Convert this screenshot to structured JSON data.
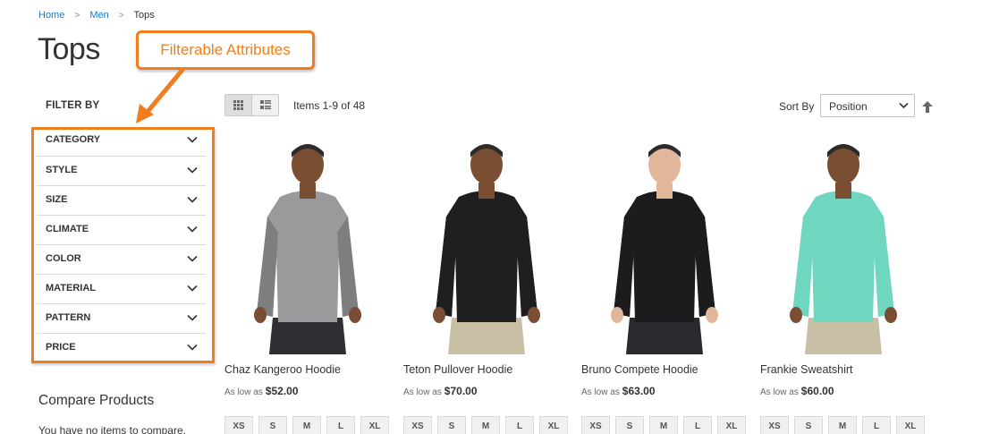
{
  "breadcrumb": {
    "home": "Home",
    "men": "Men",
    "current": "Tops",
    "separator": ">"
  },
  "page_title": "Tops",
  "callout": {
    "text": "Filterable Attributes",
    "color": "#f07d1e"
  },
  "filter": {
    "title": "FILTER BY",
    "items": [
      {
        "label": "CATEGORY"
      },
      {
        "label": "STYLE"
      },
      {
        "label": "SIZE"
      },
      {
        "label": "CLIMATE"
      },
      {
        "label": "COLOR"
      },
      {
        "label": "MATERIAL"
      },
      {
        "label": "PATTERN"
      },
      {
        "label": "PRICE"
      }
    ]
  },
  "compare": {
    "title": "Compare Products",
    "empty": "You have no items to compare."
  },
  "toolbar": {
    "items_count": "Items 1-9 of 48",
    "sort_label": "Sort By",
    "sort_value": "Position",
    "view_modes": [
      "grid-icon",
      "list-icon"
    ]
  },
  "products": [
    {
      "name": "Chaz Kangeroo Hoodie",
      "price_prefix": "As low as",
      "price": "$52.00",
      "shirt_color": "#9a9a9c",
      "sleeve_color": "#7d7e80",
      "skin": "#7a4e33",
      "pants": "#2f2f33"
    },
    {
      "name": "Teton Pullover Hoodie",
      "price_prefix": "As low as",
      "price": "$70.00",
      "shirt_color": "#1f1f22",
      "sleeve_color": "#1f1f22",
      "skin": "#7a4e33",
      "pants": "#c9bfa5"
    },
    {
      "name": "Bruno Compete Hoodie",
      "price_prefix": "As low as",
      "price": "$63.00",
      "shirt_color": "#1c1c1f",
      "sleeve_color": "#1c1c1f",
      "skin": "#e0b79a",
      "pants": "#2a2a2e"
    },
    {
      "name": "Frankie Sweatshirt",
      "price_prefix": "As low as",
      "price": "$60.00",
      "shirt_color": "#6fd6bf",
      "sleeve_color": "#6fd6bf",
      "skin": "#7a4e33",
      "pants": "#c9bfa5"
    }
  ],
  "sizes": [
    "XS",
    "S",
    "M",
    "L",
    "XL"
  ]
}
